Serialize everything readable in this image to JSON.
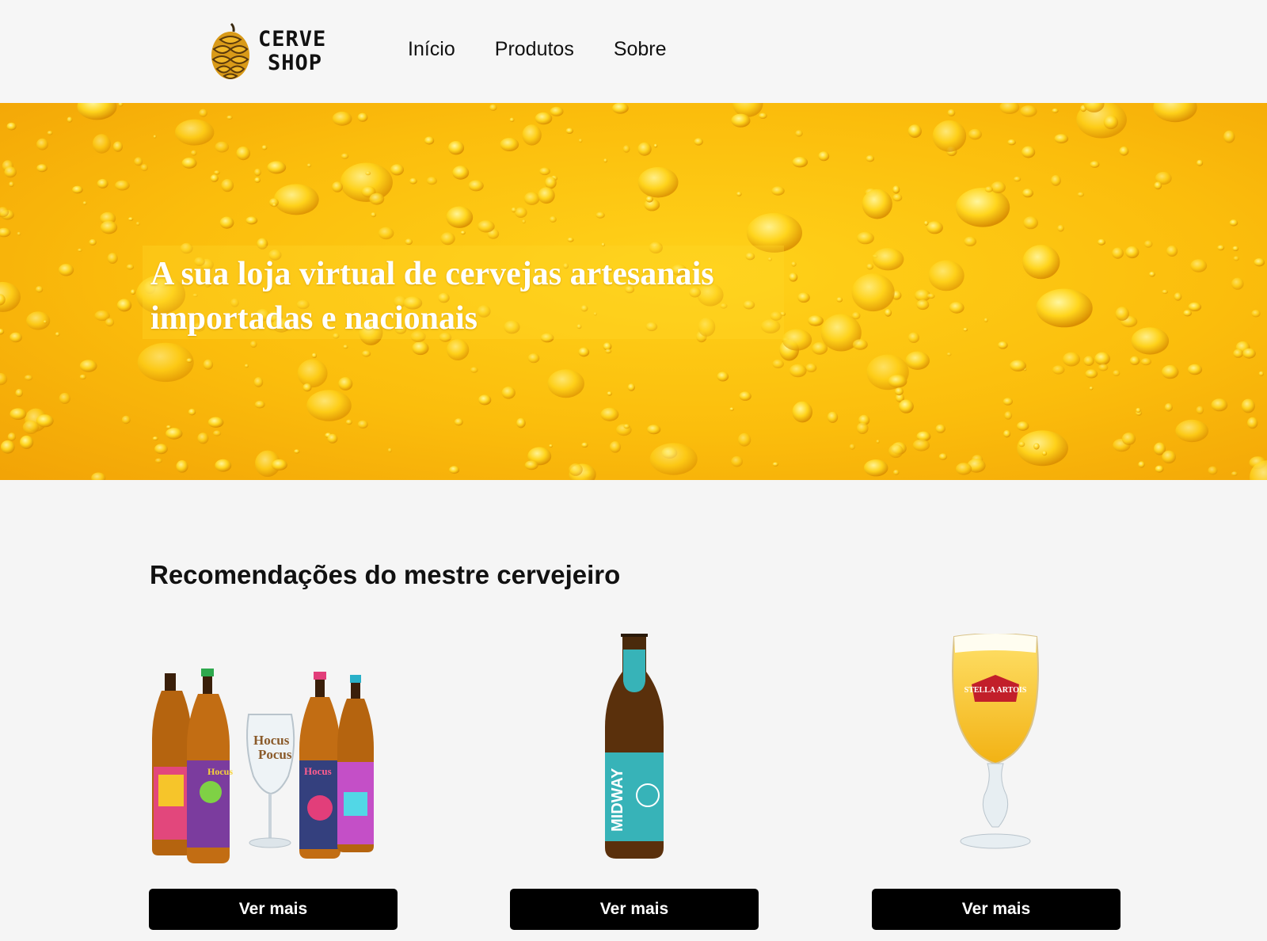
{
  "brand": {
    "line1": "CERVE",
    "line2": "SHOP"
  },
  "nav": {
    "items": [
      "Início",
      "Produtos",
      "Sobre"
    ]
  },
  "hero": {
    "title": "A sua loja virtual de cervejas artesanais importadas e nacionais"
  },
  "recommendations": {
    "title": "Recomendações do mestre cervejeiro",
    "products": [
      {
        "image": "hocus-pocus-kit-image",
        "button_label": "Ver mais"
      },
      {
        "image": "goose-island-midway-bottle-image",
        "button_label": "Ver mais"
      },
      {
        "image": "stella-artois-chalice-image",
        "button_label": "Ver mais",
        "label_text": "STELLA ARTOIS"
      }
    ]
  },
  "colors": {
    "accent": "#fbbd0c",
    "button": "#000000",
    "background": "#f5f5f5"
  }
}
